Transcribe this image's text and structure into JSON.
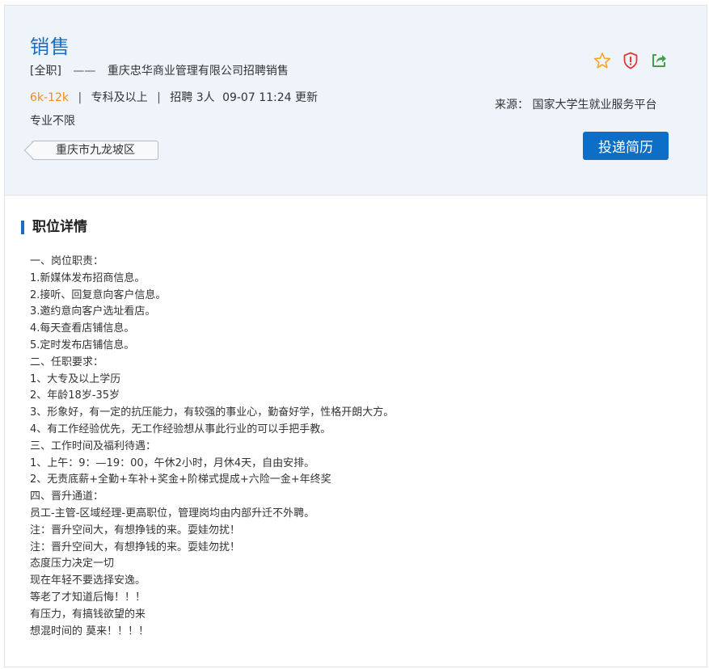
{
  "job": {
    "title": "销售",
    "type_tag": "[全职]",
    "dash": "——",
    "company_line": "重庆忠华商业管理有限公司招聘销售",
    "salary": "6k-12k",
    "separator": "|",
    "education": "专科及以上",
    "headcount": "招聘 3人",
    "updated": "09-07 11:24 更新",
    "major": "专业不限",
    "location": "重庆市九龙坡区",
    "source": "来源：  国家大学生就业服务平台",
    "apply_label": "投递简历"
  },
  "icons": {
    "favorite": "star-icon",
    "report": "shield-warning-icon",
    "share": "share-icon",
    "colors": {
      "star": "#f5a623",
      "shield": "#e53935",
      "share": "#43a047"
    }
  },
  "accent_color": "#1a6ec2",
  "salary_color": "#f28c1b",
  "section": {
    "title": "职位详情"
  },
  "description": [
    "一、岗位职责：",
    "1.新媒体发布招商信息。",
    "2.接听、回复意向客户信息。",
    "3.邀约意向客户选址看店。",
    "4.每天查看店铺信息。",
    "5.定时发布店铺信息。",
    "二、任职要求：",
    "1、大专及以上学历",
    "2、年龄18岁-35岁",
    "3、形象好，有一定的抗压能力，有较强的事业心，勤奋好学，性格开朗大方。",
    "4、有工作经验优先，无工作经验想从事此行业的可以手把手教。",
    "三、工作时间及福利待遇：",
    "1、上午：9：—19：00，午休2小时，月休4天，自由安排。",
    "2、无责底薪+全勤+车补+奖金+阶梯式提成+六险一金+年终奖",
    "四、晋升通道：",
    "员工-主管-区域经理-更高职位，管理岗均由内部升迁不外聘。",
    "注：晋升空间大，有想挣钱的来。耍娃勿扰！",
    "注：晋升空间大，有想挣钱的来。耍娃勿扰！",
    "态度压力决定一切",
    "现在年轻不要选择安逸。",
    "等老了才知道后悔！！！",
    "有压力，有搞钱欲望的来",
    "想混时间的 莫来！！！！"
  ]
}
